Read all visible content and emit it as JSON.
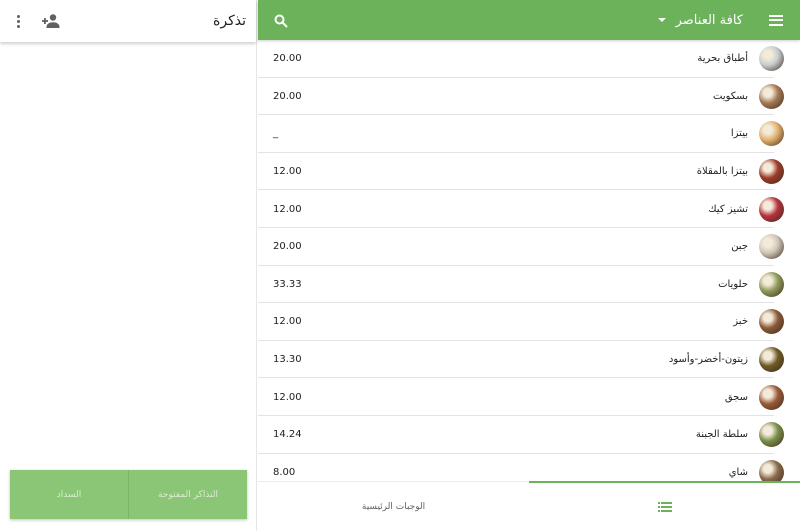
{
  "ticket": {
    "title": "تذكرة",
    "buttons": {
      "open_tickets": "التذاكر المفتوحة",
      "charge": "السداد"
    }
  },
  "toolbar": {
    "category": "كافة العناصر"
  },
  "items": [
    {
      "name": "أطباق بحرية",
      "price": "20.00",
      "thumb_color": "#c9cdd0"
    },
    {
      "name": "بسكويت",
      "price": "20.00",
      "thumb_color": "#a47a55"
    },
    {
      "name": "بيتزا",
      "price": "_",
      "thumb_color": "#e2b06d"
    },
    {
      "name": "بيتزا بالمقلاة",
      "price": "12.00",
      "thumb_color": "#9e3b2a"
    },
    {
      "name": "تشيز كيك",
      "price": "12.00",
      "thumb_color": "#b5323c"
    },
    {
      "name": "جبن",
      "price": "20.00",
      "thumb_color": "#cfc6b8"
    },
    {
      "name": "حلويات",
      "price": "33.33",
      "thumb_color": "#8f9a5b"
    },
    {
      "name": "خبز",
      "price": "12.00",
      "thumb_color": "#8a5a38"
    },
    {
      "name": "زيتون-أخضر-وأسود",
      "price": "13.30",
      "thumb_color": "#6e5a26"
    },
    {
      "name": "سجق",
      "price": "12.00",
      "thumb_color": "#9a5a38"
    },
    {
      "name": "سلطة الجبنة",
      "price": "14.24",
      "thumb_color": "#7a8f4a"
    },
    {
      "name": "شاي",
      "price": "8.00",
      "thumb_color": "#8a6a4a"
    }
  ],
  "bottom_nav": {
    "main_dishes": "الوجبات الرئيسية"
  },
  "colors": {
    "primary": "#6bb25a",
    "button": "#8bc576"
  }
}
